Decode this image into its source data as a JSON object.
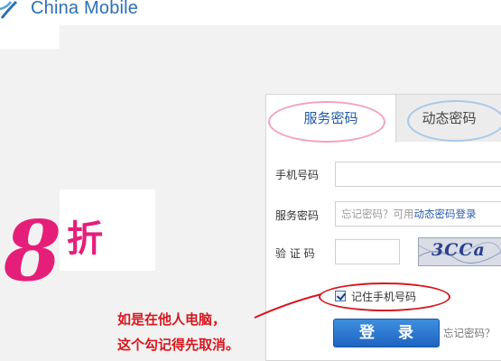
{
  "brand": {
    "logo_text": "China Mobile"
  },
  "promo": {
    "graphic_text": "8折"
  },
  "login": {
    "tabs": [
      {
        "label": "服务密码"
      },
      {
        "label": "动态密码"
      }
    ],
    "phone_label": "手机号码",
    "service_pwd_label": "服务密码",
    "service_pwd_hint": "忘记密码？可用",
    "service_pwd_hint_link": "动态密码登录",
    "captcha_label": "验 证 码",
    "captcha_text": "3CCa",
    "remember_label": "记住手机号码",
    "remember_checked": true,
    "login_button": "登 录",
    "forgot_link": "忘记密码？"
  },
  "annotation": {
    "line1": "如是在他人电脑，",
    "line2": "这个勾记得先取消。"
  },
  "colors": {
    "brand_blue": "#2d6fb5",
    "tab_active_text": "#1f58a8",
    "annotation_red": "#d7181f",
    "promo_pink": "#e51f79"
  }
}
